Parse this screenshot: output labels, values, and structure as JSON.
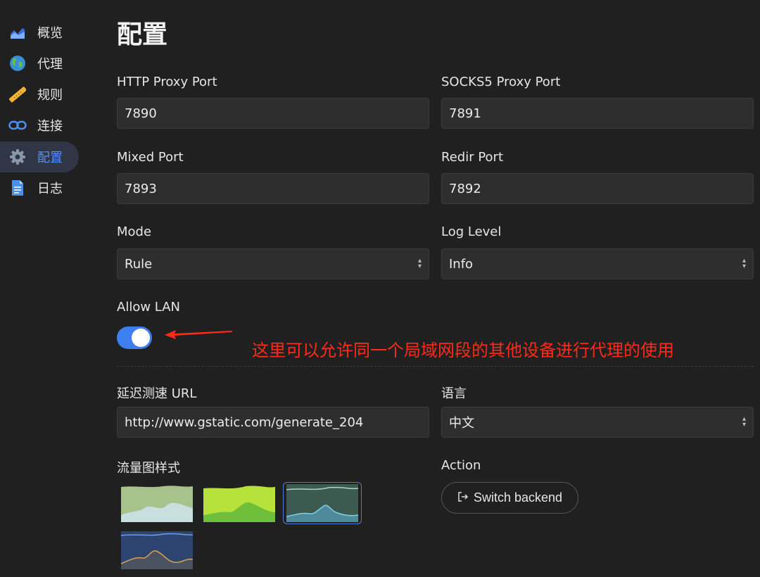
{
  "sidebar": {
    "items": [
      {
        "label": "概览",
        "icon": "overview-chart-icon"
      },
      {
        "label": "代理",
        "icon": "globe-icon"
      },
      {
        "label": "规则",
        "icon": "ruler-icon"
      },
      {
        "label": "连接",
        "icon": "link-icon"
      },
      {
        "label": "配置",
        "icon": "gear-icon",
        "active": true
      },
      {
        "label": "日志",
        "icon": "document-icon"
      }
    ]
  },
  "page": {
    "title": "配置"
  },
  "fields": {
    "http_port": {
      "label": "HTTP Proxy Port",
      "value": "7890"
    },
    "socks_port": {
      "label": "SOCKS5 Proxy Port",
      "value": "7891"
    },
    "mixed_port": {
      "label": "Mixed Port",
      "value": "7893"
    },
    "redir_port": {
      "label": "Redir Port",
      "value": "7892"
    },
    "mode": {
      "label": "Mode",
      "value": "Rule"
    },
    "log_level": {
      "label": "Log Level",
      "value": "Info"
    },
    "allow_lan": {
      "label": "Allow LAN",
      "enabled": true
    },
    "latency_url": {
      "label": "延迟测速 URL",
      "value": "http://www.gstatic.com/generate_204"
    },
    "language": {
      "label": "语言",
      "value": "中文"
    },
    "traffic_style": {
      "label": "流量图样式",
      "selected_index": 2
    },
    "action": {
      "label": "Action",
      "button": "Switch backend"
    }
  },
  "annotation": {
    "text": "这里可以允许同一个局域网段的其他设备进行代理的使用",
    "color": "#ff2a1a"
  },
  "colors": {
    "accent": "#3d7ef0",
    "active_nav_bg": "#303646",
    "active_nav_text": "#5a8df2"
  }
}
